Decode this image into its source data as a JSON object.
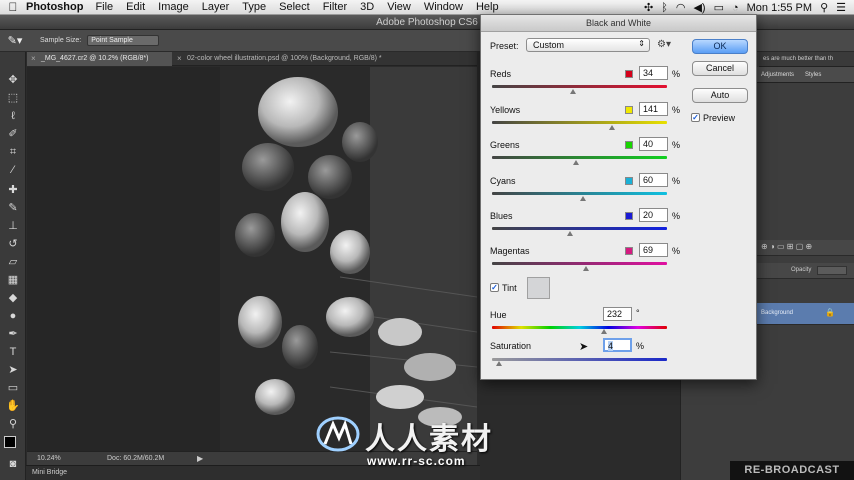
{
  "menubar": {
    "app_name": "Photoshop",
    "items": [
      "File",
      "Edit",
      "Image",
      "Layer",
      "Type",
      "Select",
      "Filter",
      "3D",
      "View",
      "Window",
      "Help"
    ],
    "clock": "Mon 1:55 PM"
  },
  "window": {
    "title": "Adobe Photoshop CS6"
  },
  "options": {
    "sample_size_label": "Sample Size:",
    "sample_size_value": "Point Sample"
  },
  "tabs": [
    {
      "label": "_MG_4627.cr2 @ 10.2% (RGB/8*)"
    },
    {
      "label": "02-color wheel illustration.psd @ 100% (Background, RGB/8) *"
    }
  ],
  "statusbar": {
    "zoom": "10.24%",
    "doc": "Doc: 60.2M/60.2M"
  },
  "minibridge": {
    "label": "Mini Bridge"
  },
  "right_panel": {
    "adjustments_tab": "Adjustments",
    "styles_tab": "Styles",
    "opacity_label": "Opacity",
    "layer_name": "Background",
    "partial_text": "es are much better than th"
  },
  "dialog": {
    "title": "Black and White",
    "preset_label": "Preset:",
    "preset_value": "Custom",
    "ok": "OK",
    "cancel": "Cancel",
    "auto": "Auto",
    "preview_label": "Preview",
    "preview_checked": true,
    "tint_label": "Tint",
    "tint_checked": true,
    "tint_swatch_color": "#d4d5d7",
    "sliders": [
      {
        "name": "Reds",
        "value": "34",
        "unit": "%",
        "color": "#d4001a",
        "pos": 0.46
      },
      {
        "name": "Yellows",
        "value": "141",
        "unit": "%",
        "color": "#f0e800",
        "pos": 0.69
      },
      {
        "name": "Greens",
        "value": "40",
        "unit": "%",
        "color": "#18d400",
        "pos": 0.48
      },
      {
        "name": "Cyans",
        "value": "60",
        "unit": "%",
        "color": "#1ab0d6",
        "pos": 0.52
      },
      {
        "name": "Blues",
        "value": "20",
        "unit": "%",
        "color": "#1a1ad4",
        "pos": 0.43
      },
      {
        "name": "Magentas",
        "value": "69",
        "unit": "%",
        "color": "#d41a80",
        "pos": 0.55
      }
    ],
    "hue": {
      "label": "Hue",
      "value": "232",
      "unit": "°",
      "pos": 0.64
    },
    "saturation": {
      "label": "Saturation",
      "value": "4",
      "unit": "%",
      "pos": 0.04
    }
  },
  "watermark": {
    "text": "人人素材",
    "url": "www.rr-sc.com"
  },
  "overlay": {
    "rebroadcast": "RE-BROADCAST"
  }
}
